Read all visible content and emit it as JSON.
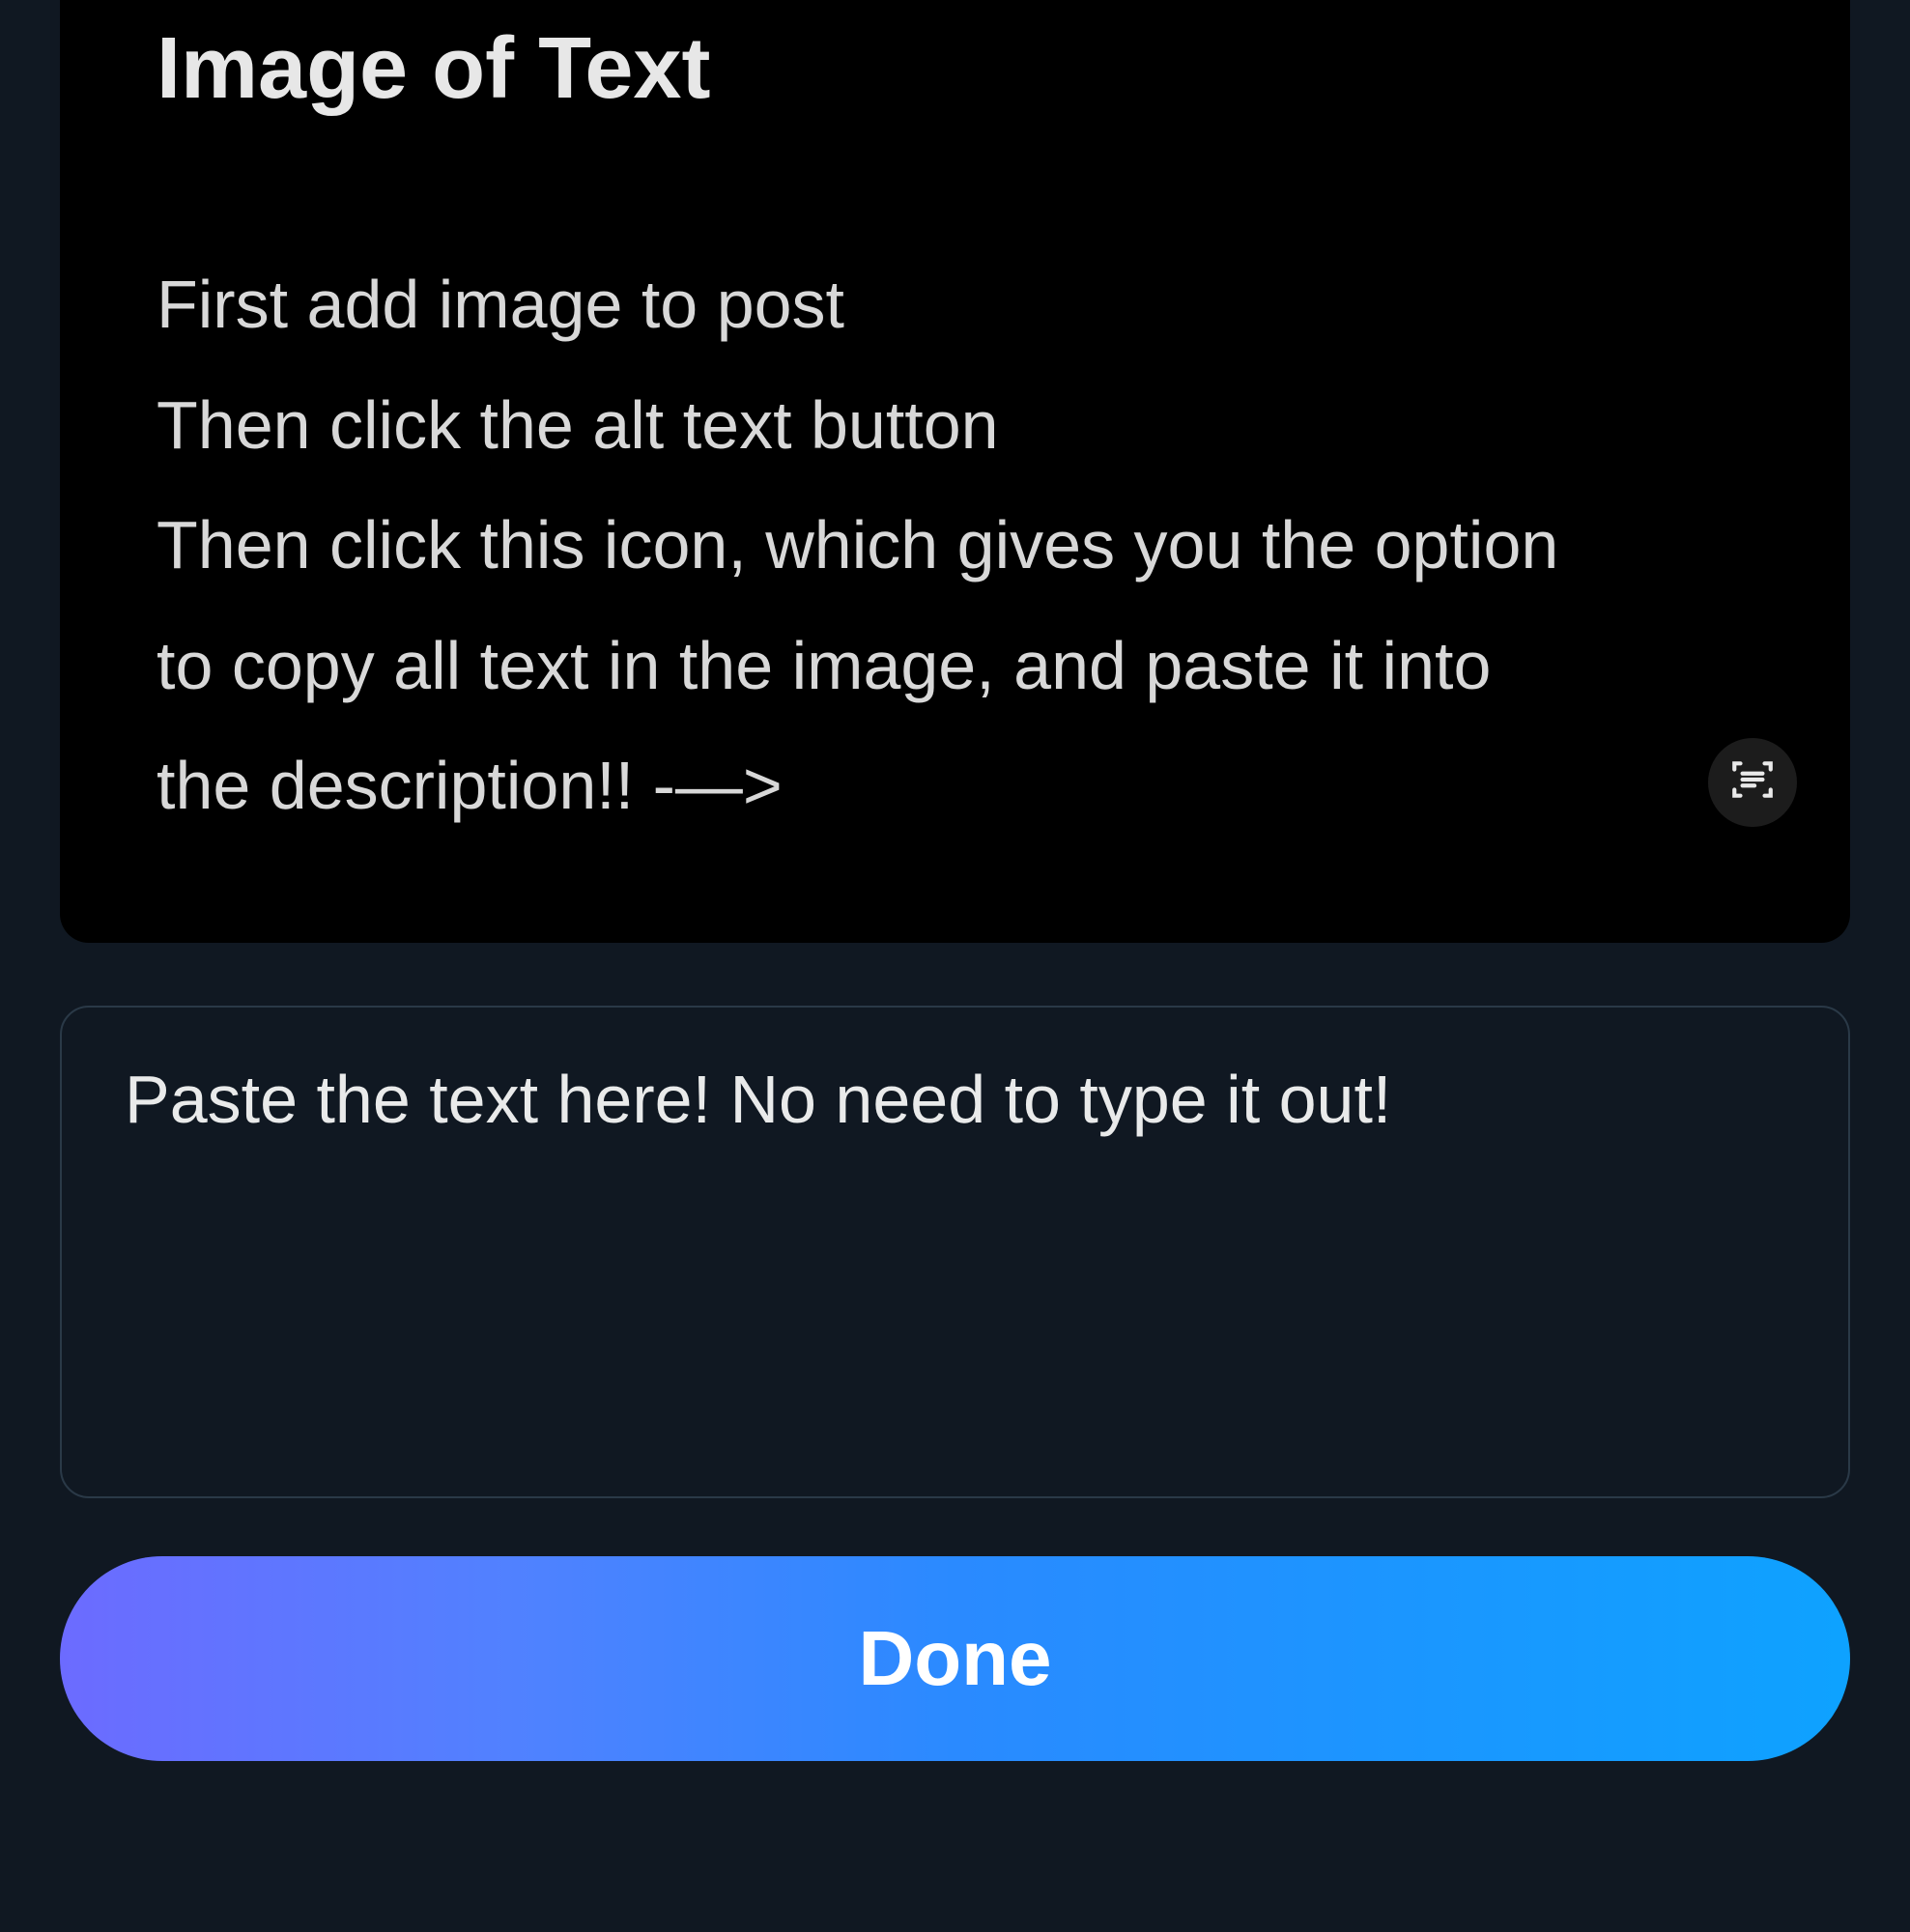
{
  "image": {
    "title": "Image of Text",
    "body": "First add image to post\nThen click the alt text button\nThen click this icon, which gives you the option to copy all text in the image, and paste it into the description!!  -—>"
  },
  "description": {
    "placeholder": "Paste the text here! No need to type it out!",
    "value": ""
  },
  "buttons": {
    "done": "Done"
  },
  "icons": {
    "scan": "text-scan-icon"
  }
}
